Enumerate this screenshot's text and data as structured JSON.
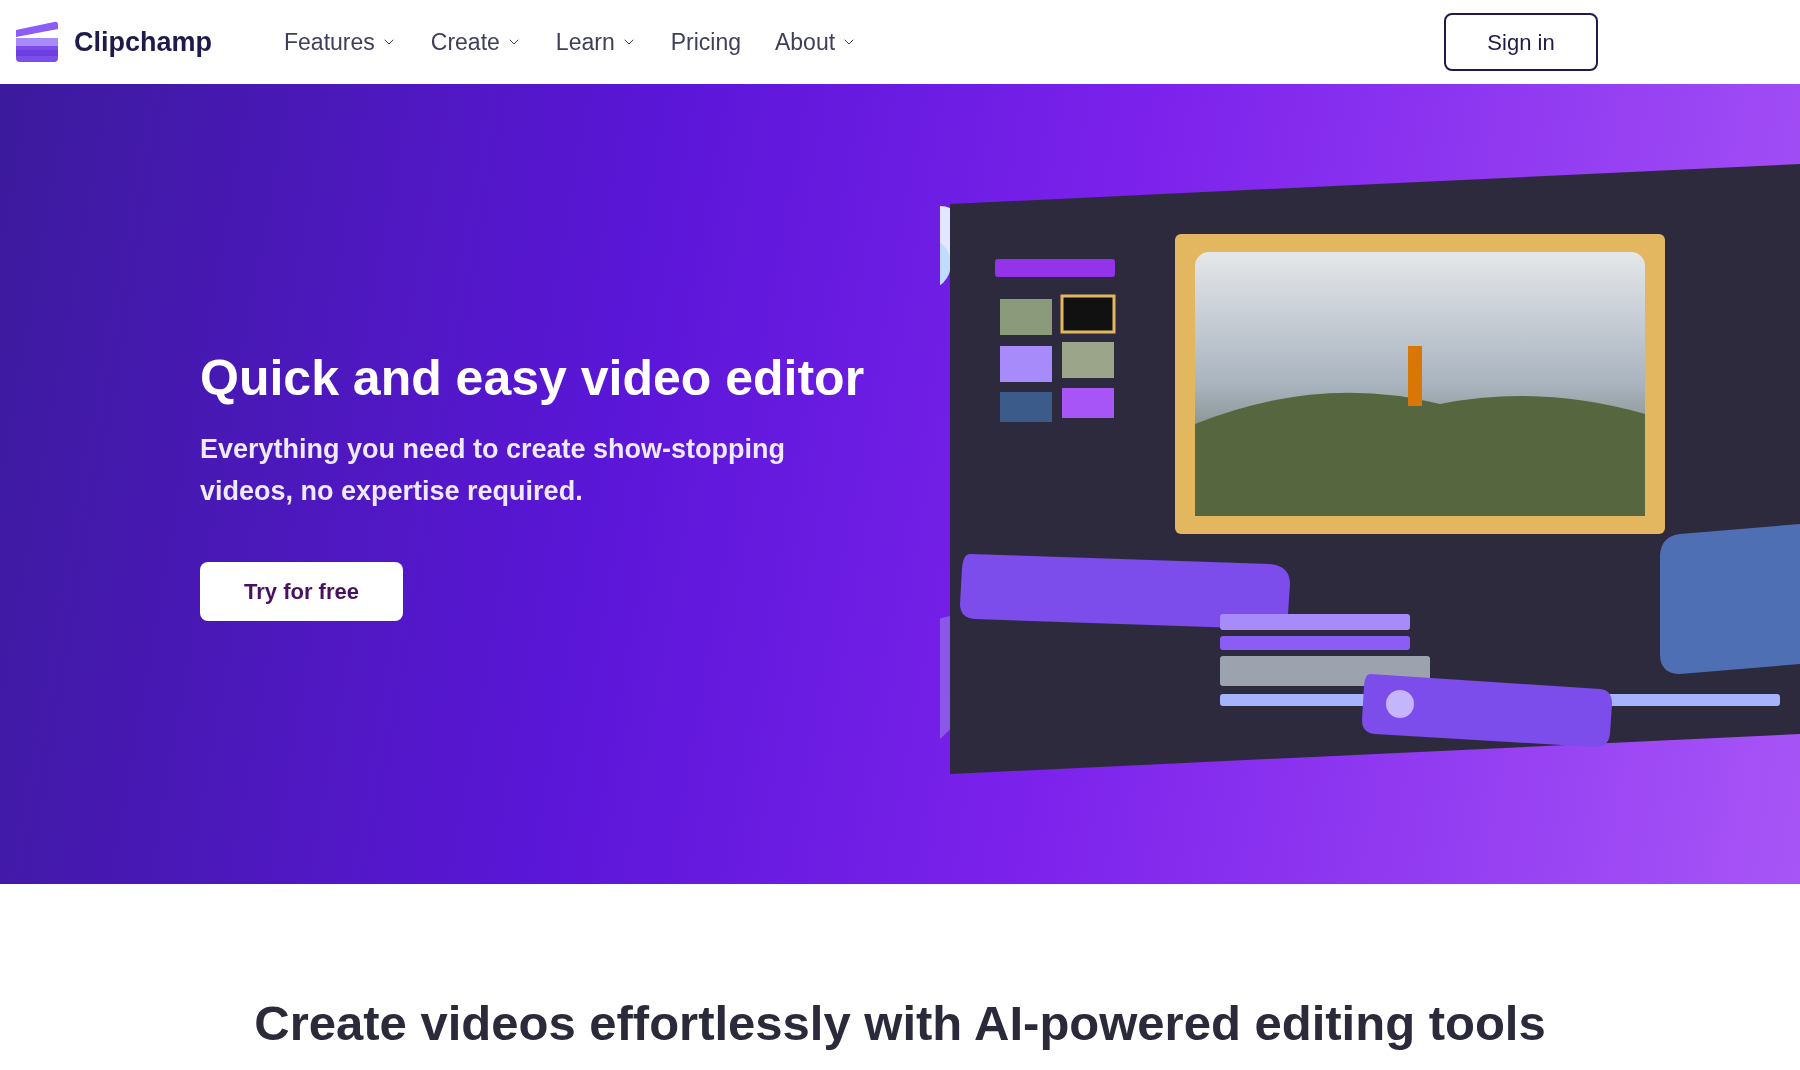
{
  "header": {
    "brand": "Clipchamp",
    "nav": [
      {
        "label": "Features",
        "dropdown": true
      },
      {
        "label": "Create",
        "dropdown": true
      },
      {
        "label": "Learn",
        "dropdown": true
      },
      {
        "label": "Pricing",
        "dropdown": false
      },
      {
        "label": "About",
        "dropdown": true
      }
    ],
    "sign_in": "Sign in"
  },
  "hero": {
    "title": "Quick and easy video editor",
    "subtitle": "Everything you need to create show-stopping videos, no expertise required.",
    "cta": "Try for free"
  },
  "section": {
    "title": "Create videos effortlessly with AI-powered editing tools"
  }
}
